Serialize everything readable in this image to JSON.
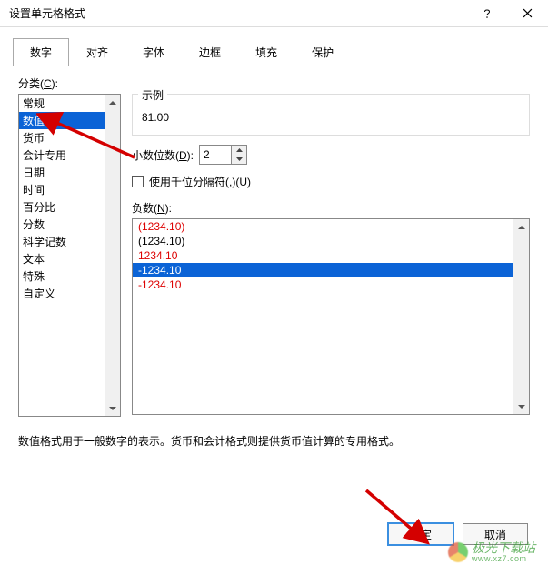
{
  "title": "设置单元格格式",
  "titlebar": {
    "help_icon": "help-icon",
    "close_icon": "close-icon"
  },
  "tabs": [
    "数字",
    "对齐",
    "字体",
    "边框",
    "填充",
    "保护"
  ],
  "active_tab_index": 0,
  "category_label_pre": "分类(",
  "category_label_key": "C",
  "category_label_post": "):",
  "categories": [
    "常规",
    "数值",
    "货币",
    "会计专用",
    "日期",
    "时间",
    "百分比",
    "分数",
    "科学记数",
    "文本",
    "特殊",
    "自定义"
  ],
  "selected_category_index": 1,
  "example_label": "示例",
  "example_value": "81.00",
  "decimal_label_pre": "小数位数(",
  "decimal_label_key": "D",
  "decimal_label_post": "):",
  "decimal_value": "2",
  "thousands_label_pre": "使用千位分隔符(,)(",
  "thousands_label_key": "U",
  "thousands_label_post": ")",
  "thousands_checked": false,
  "neg_label_pre": "负数(",
  "neg_label_key": "N",
  "neg_label_post": "):",
  "neg_options": [
    {
      "text": "(1234.10)",
      "red": true
    },
    {
      "text": "(1234.10)",
      "red": false
    },
    {
      "text": "1234.10",
      "red": true
    },
    {
      "text": "-1234.10",
      "red": false,
      "selected": true
    },
    {
      "text": "-1234.10",
      "red": true
    }
  ],
  "description": "数值格式用于一般数字的表示。货币和会计格式则提供货币值计算的专用格式。",
  "ok_label": "确定",
  "cancel_label": "取消",
  "watermark": {
    "line1": "极光下载站",
    "line2": "www.xz7.com"
  }
}
